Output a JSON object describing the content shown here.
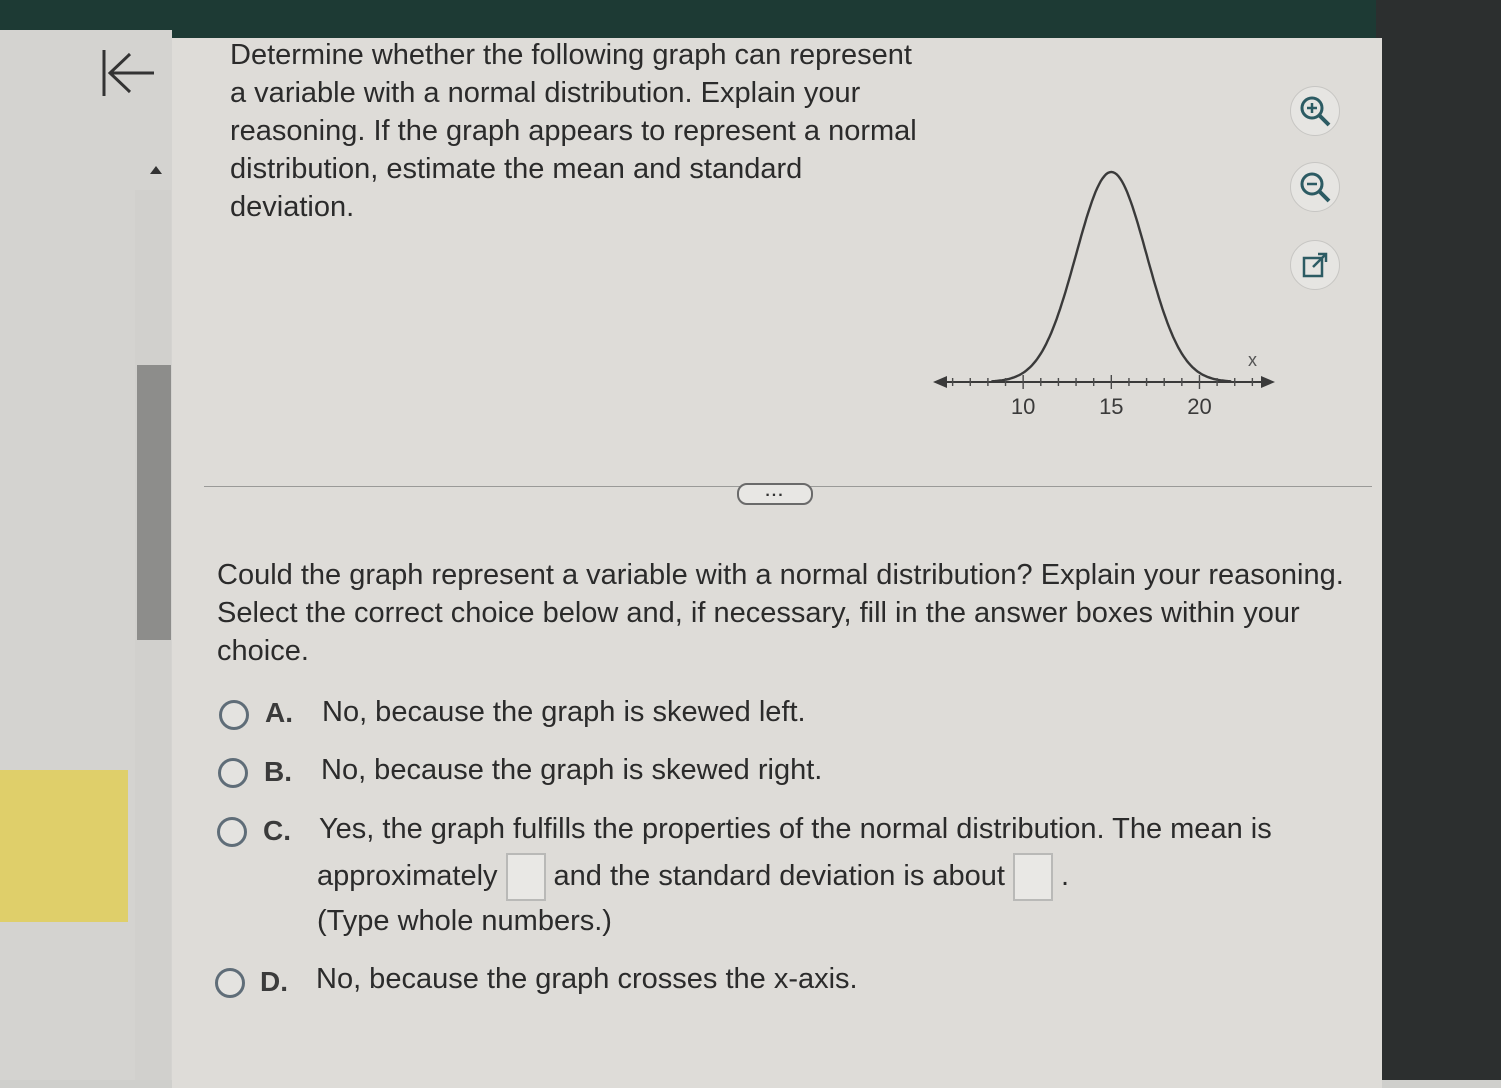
{
  "question": {
    "text": "Determine whether the following graph can represent a variable with a normal distribution. Explain your reasoning. If the graph appears to represent a normal distribution, estimate the mean and standard deviation."
  },
  "toolbar": {
    "zoom_in_icon": "zoom-in-icon",
    "zoom_out_icon": "zoom-out-icon",
    "popout_icon": "popout-icon"
  },
  "chart_data": {
    "type": "line",
    "xlabel": "x",
    "x_ticks": [
      10,
      15,
      20
    ],
    "curve": "normal",
    "mean": 15,
    "sd": 2,
    "grid": false
  },
  "more_button": "...",
  "prompt": "Could the graph represent a variable with a normal distribution? Explain your reasoning. Select the correct choice below and, if necessary, fill in the answer boxes within your choice.",
  "choices": [
    {
      "letter": "A.",
      "text": "No, because the graph is skewed left."
    },
    {
      "letter": "B.",
      "text": "No, because the graph is skewed right."
    },
    {
      "letter": "C.",
      "text_part1": "Yes, the graph fulfills the properties of the normal distribution. The mean is",
      "text_part2": "approximately",
      "text_part3": "and the standard deviation is about",
      "text_part4": ".",
      "note": "(Type whole numbers.)"
    },
    {
      "letter": "D.",
      "text": "No, because the graph crosses the x-axis."
    }
  ],
  "colors": {
    "radio_border": "#5f6d78",
    "top_bar": "#1d3a34",
    "note_yellow": "#dfcf6a"
  }
}
